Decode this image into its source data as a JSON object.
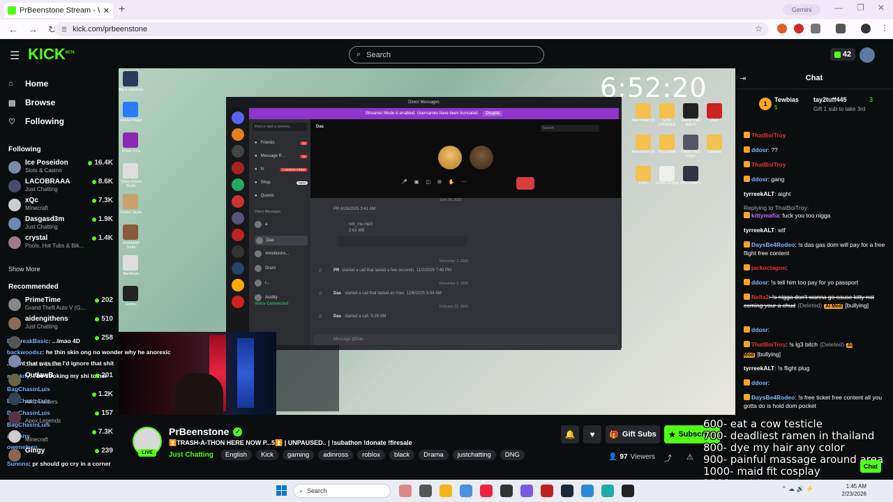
{
  "browser": {
    "tab_title": "PrBeenstone Stream - Watch Li",
    "tab_close": "✕",
    "new_tab": "+",
    "gemini": "Gemini",
    "url": "kick.com/prbeenstone"
  },
  "kick": {
    "logo": "KICK",
    "logo_beta": "BETA",
    "search_placeholder": "Search",
    "points": "42"
  },
  "sidebar": {
    "nav": [
      {
        "label": "Home",
        "icon": "⌂"
      },
      {
        "label": "Browse",
        "icon": "▤"
      },
      {
        "label": "Following",
        "icon": "♡"
      }
    ],
    "following_heading": "Following",
    "following": [
      {
        "name": "Ice Poseidon",
        "category": "Slots & Casino",
        "viewers": "16.4K",
        "color": "#7a8aa8"
      },
      {
        "name": "LACOBRAAA",
        "category": "Just Chatting",
        "viewers": "8.6K",
        "color": "#4a4a6a"
      },
      {
        "name": "xQc",
        "category": "Minecraft",
        "viewers": "7.3K",
        "color": "#ccc"
      },
      {
        "name": "Dasgasd3m",
        "category": "Just Chatting",
        "viewers": "1.9K",
        "color": "#6a8ab0"
      },
      {
        "name": "crystal",
        "category": "Pools, Hot Tubs & Bik...",
        "viewers": "1.4K",
        "color": "#a07a8a"
      }
    ],
    "show_more": "Show More",
    "recommended_heading": "Recommended",
    "recommended": [
      {
        "name": "PrimeTime",
        "category": "Grand Theft Auto V (G...",
        "viewers": "202",
        "color": "#888"
      },
      {
        "name": "aidengithens",
        "category": "Just Chatting",
        "viewers": "510",
        "color": "#8a6a5a"
      },
      {
        "name": "",
        "category": "",
        "viewers": "258",
        "color": "#555"
      },
      {
        "name": "",
        "category": "Slots & Casino",
        "viewers": "",
        "color": "#7a8aa8"
      },
      {
        "name": "OutlawB",
        "category": "",
        "viewers": "201",
        "color": "#664"
      },
      {
        "name": "",
        "category": "ARC Raiders",
        "viewers": "1.2K",
        "color": "#345"
      },
      {
        "name": "",
        "category": "Apex Legends",
        "viewers": "157",
        "color": "#534"
      },
      {
        "name": "",
        "category": "Minecraft",
        "viewers": "7.3K",
        "color": "#ccc"
      },
      {
        "name": "Gingy",
        "category": "",
        "viewers": "239",
        "color": "#865"
      }
    ]
  },
  "stream": {
    "timer": "6:52:20",
    "desktop_right_labels": [
      "New Folder (2)",
      "GOD CONSOLE",
      "Grand Theft Auto V",
      "Rust",
      "New Folder (3)",
      "PBS GAME",
      "Fallout: New Vegas",
      "Cuphead",
      "LUGI",
      "GONE Fishing",
      "ARC Raiders"
    ],
    "desktop_left_labels": [
      "Big & Lobotomy",
      "Roblox Player",
      "Winter Foxy",
      "Yoooo Roblox Studio",
      "Roblox Studio",
      "RRAAASP Studio",
      "Bandicam",
      "Roblox"
    ],
    "discord": {
      "window_title": "Direct Messages",
      "banner": "Streamer Mode is enabled. Usernames have been truncated.",
      "banner_btn": "Disable",
      "find": "Find or start a convers...",
      "channels": [
        {
          "label": "Friends",
          "badge": "24",
          "kind": "pill"
        },
        {
          "label": "Message R...",
          "badge": "11",
          "kind": "pill"
        },
        {
          "label": "N.",
          "badge": "1 MONTH FREE",
          "kind": "pill"
        },
        {
          "label": "Shop",
          "badge": "NEW",
          "kind": "new"
        },
        {
          "label": "Quests",
          "badge": "",
          "kind": ""
        }
      ],
      "dm_heading": "Direct Messages",
      "dms": [
        "a",
        "Das",
        "#mistlordrx...",
        "Grunt",
        "r...",
        "Acidity"
      ],
      "dm_sub": "In a call",
      "voice_connected": "Voice Connected",
      "voice_sub": "Das",
      "chat_name": "Das",
      "search": "Search",
      "messages": [
        {
          "text": "PR  6/26/2025 3:41 AM"
        },
        {
          "text": "rob_me.mp3"
        },
        {
          "text": "2.63 MB"
        },
        {
          "text": "-:-- / -:--"
        }
      ],
      "dates": [
        "June 26, 2025",
        "November 2, 2025",
        "December 6, 2025",
        "February 23, 2026"
      ],
      "calls": [
        {
          "name": "PR",
          "text": "started a call that lasted a few seconds.  11/2/2025 7:49 PM"
        },
        {
          "name": "Das",
          "text": "started a call that lasted an hour.  12/6/2025 5:04 AM"
        },
        {
          "name": "Das",
          "text": "started a call.  5:26 AM"
        }
      ],
      "input_placeholder": "Message @Das"
    },
    "overlay_chat": [
      {
        "user": "DisBreakBasic",
        "text": ": ...lmao 4D"
      },
      {
        "user": "backwoodsz",
        "text": ": he thin skin ong no wonder why he anorexic"
      },
      {
        "user": "",
        "text": "...right that was the I'd ignore that shit"
      },
      {
        "user": "anthkny",
        "text": ": I be stroking my shi to her"
      },
      {
        "user": "BagChasinLuis",
        "text": ""
      },
      {
        "user": "BagChasinLuis",
        "text": ""
      },
      {
        "user": "BagChasinLuis",
        "text": ""
      },
      {
        "user": "BagChasinLuis",
        "text": ""
      },
      {
        "user": "anthkny",
        "text": ""
      },
      {
        "user": "owenelnen",
        "text": ""
      },
      {
        "user": "Sunnna",
        "text": ": pr should go cry in a corner"
      },
      {
        "user": "Lilskoolbuss",
        "text": ": I wouldn't be in my feelings bout that shit"
      },
      {
        "user": "lover",
        "text": ": fr pr thin skin af"
      }
    ]
  },
  "channel": {
    "name": "PrBeenstone",
    "live": "LIVE",
    "title": "⏫TRASH-A-THON HERE NOW P...5⏫ | UNPAUSED.. | !subathon !donate !firesale",
    "category": "Just Chatting",
    "tags": [
      "English",
      "Kick",
      "gaming",
      "adinross",
      "roblox",
      "black",
      "Drama",
      "justchatting",
      "DNG"
    ],
    "gift_subs": "Gift Subs",
    "subscribe": "Subscribe",
    "viewers": "97",
    "viewers_label": "Viewers"
  },
  "goals": [
    "600- eat a cow testicle",
    "700- deadliest ramen in thailand",
    "800- dye my hair any color",
    "900- painful massage around area",
    "1000- maid fit cosplay",
    "1100- eat hot... wings",
    "1500- muay thai ... ..."
  ],
  "chat": {
    "title": "Chat",
    "leaderboard": [
      {
        "name": "Tewbias",
        "count": "5"
      },
      {
        "name": "tay2tuff445",
        "count": "3"
      }
    ],
    "leader_note": "Gift 1 sub to take 3rd",
    "messages": [
      {
        "user": "ThatBoiTroy",
        "color": "#e8323c",
        "text": ""
      },
      {
        "user": "ddosr",
        "color": "#7ab8ff",
        "text": ": ??"
      },
      {
        "user": "ThatBoiTroy",
        "color": "#e8323c",
        "text": ""
      },
      {
        "user": "ddosr",
        "color": "#7ab8ff",
        "text": ": gang"
      },
      {
        "user": "tyrreekALT",
        "color": "#fff",
        "text": ": aight"
      },
      {
        "user": "Replying to ThatBoiTroy:",
        "color": "#aaa",
        "text": ""
      },
      {
        "user": "kittymafia",
        "color": "#c06bff",
        "text": ": fuck you too nigga"
      },
      {
        "user": "tyrreekALT",
        "color": "#fff",
        "text": ": wtf"
      },
      {
        "user": "DaysBe4Rodeo",
        "color": "#7ab8ff",
        "text": ": !s das gas dom will pay for a free flight free content"
      },
      {
        "user": "jackoctagon",
        "color": "#e8323c",
        "text": ":"
      },
      {
        "user": "ddosr",
        "color": "#7ab8ff",
        "text": ": !s tell him too pay for yo passport"
      },
      {
        "user": "Nella2",
        "color": "#e8323c",
        "text": ": !s nigga don't wanna go cause kitty not coming your a chud"
      },
      {
        "user": "ddosr",
        "color": "#7ab8ff",
        "text": ":"
      },
      {
        "user": "ThatBoiTroy",
        "color": "#e8323c",
        "text": ": !s lg3 bitch"
      },
      {
        "user": "tyrreekALT",
        "color": "#fff",
        "text": ": !s flight plug"
      },
      {
        "user": "ddosr",
        "color": "#7ab8ff",
        "text": ":"
      },
      {
        "user": "DaysBe4Rodeo",
        "color": "#7ab8ff",
        "text": ": !s free ticket free content all you gotta do is hold dom pocket"
      }
    ],
    "deleted": "(Deleted)",
    "ai_mod": "AI Mod",
    "bullying": "[bullying]",
    "chat_button": "Chat"
  },
  "taskbar": {
    "search": "Search",
    "time": "1:45 AM",
    "date": "2/23/2026"
  }
}
